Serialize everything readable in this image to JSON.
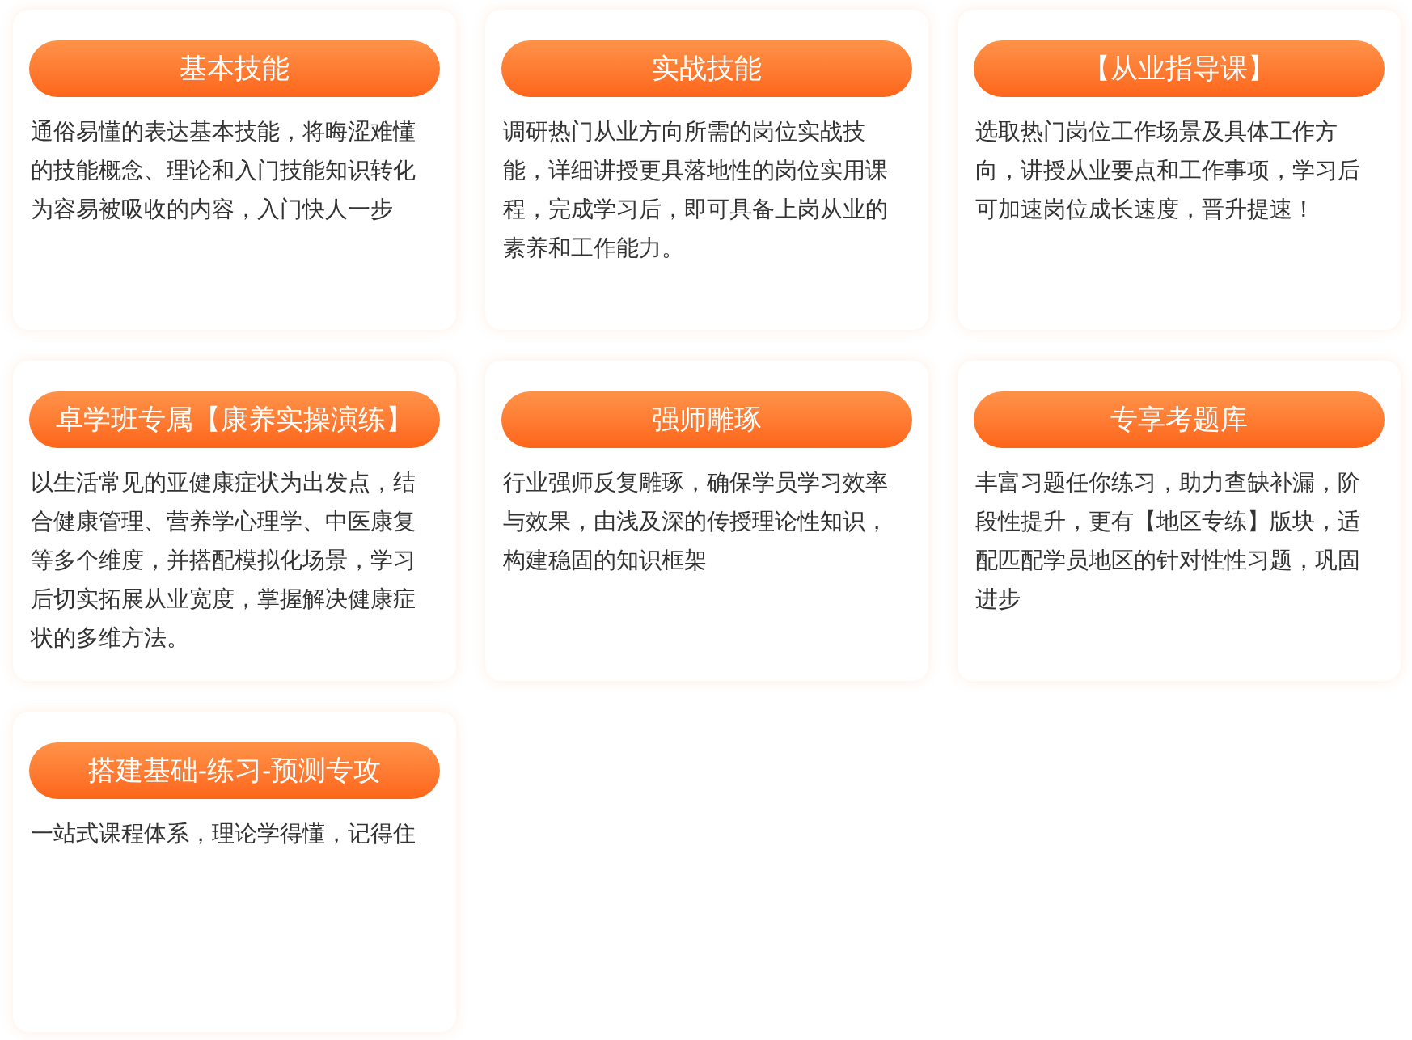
{
  "cards": [
    {
      "title": "基本技能",
      "description": "通俗易懂的表达基本技能，将晦涩难懂的技能概念、理论和入门技能知识转化为容易被吸收的内容，入门快人一步"
    },
    {
      "title": "实战技能",
      "description": "调研热门从业方向所需的岗位实战技能，详细讲授更具落地性的岗位实用课程，完成学习后，即可具备上岗从业的素养和工作能力。"
    },
    {
      "title": "【从业指导课】",
      "description": "选取热门岗位工作场景及具体工作方向，讲授从业要点和工作事项，学习后可加速岗位成长速度，晋升提速！"
    },
    {
      "title": "卓学班专属【康养实操演练】",
      "description": "以生活常见的亚健康症状为出发点，结合健康管理、营养学心理学、中医康复等多个维度，并搭配模拟化场景，学习后切实拓展从业宽度，掌握解决健康症状的多维方法。"
    },
    {
      "title": "强师雕琢",
      "description": "行业强师反复雕琢，确保学员学习效率与效果，由浅及深的传授理论性知识，构建稳固的知识框架"
    },
    {
      "title": "专享考题库",
      "description": "丰富习题任你练习，助力查缺补漏，阶段性提升，更有【地区专练】版块，适配匹配学员地区的针对性性习题，巩固进步"
    },
    {
      "title": "搭建基础-练习-预测专攻",
      "description": "一站式课程体系，理论学得懂，记得住"
    }
  ]
}
